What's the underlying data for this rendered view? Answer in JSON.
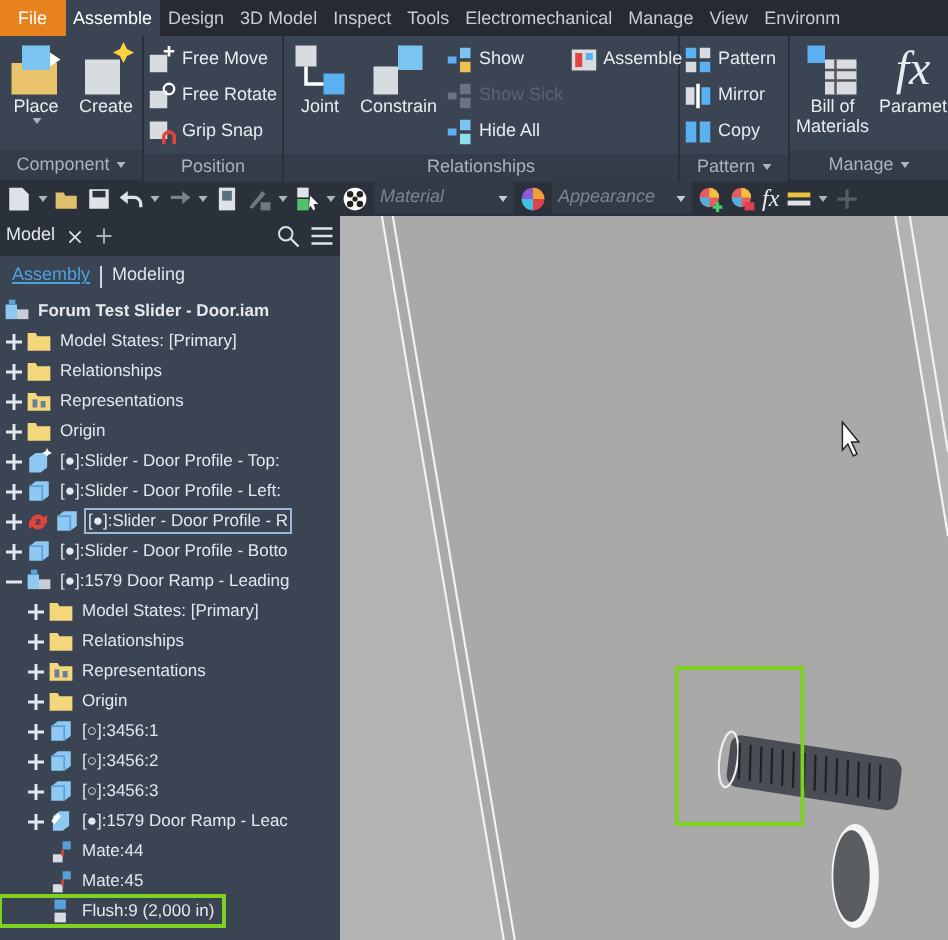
{
  "tabs": [
    {
      "label": "File",
      "kind": "file",
      "selected": false
    },
    {
      "label": "Assemble",
      "kind": "tab",
      "selected": true
    },
    {
      "label": "Design",
      "kind": "tab",
      "selected": false
    },
    {
      "label": "3D Model",
      "kind": "tab",
      "selected": false
    },
    {
      "label": "Inspect",
      "kind": "tab",
      "selected": false
    },
    {
      "label": "Tools",
      "kind": "tab",
      "selected": false
    },
    {
      "label": "Electromechanical",
      "kind": "tab",
      "selected": false
    },
    {
      "label": "Manage",
      "kind": "tab",
      "selected": false
    },
    {
      "label": "View",
      "kind": "tab",
      "selected": false
    },
    {
      "label": "Environm",
      "kind": "tab",
      "selected": false
    }
  ],
  "ribbon": {
    "panels": [
      {
        "title": "Component",
        "menu": true,
        "groups": [
          {
            "kind": "large",
            "tools": [
              {
                "label": "Place",
                "kind": "place",
                "menu": true,
                "disabled": false
              },
              {
                "label": "Create",
                "kind": "create",
                "menu": false,
                "disabled": false
              }
            ]
          }
        ]
      },
      {
        "title": "Position",
        "menu": false,
        "groups": [
          {
            "kind": "small",
            "tools": [
              {
                "label": "Free Move",
                "kind": "free-move",
                "disabled": false
              },
              {
                "label": "Free Rotate",
                "kind": "free-rotate",
                "disabled": false
              },
              {
                "label": "Grip Snap",
                "kind": "grip-snap",
                "disabled": false
              }
            ]
          }
        ]
      },
      {
        "title": "Relationships",
        "menu": false,
        "groups": [
          {
            "kind": "large",
            "tools": [
              {
                "label": "Joint",
                "kind": "joint",
                "menu": false,
                "disabled": false
              },
              {
                "label": "Constrain",
                "kind": "constrain",
                "menu": false,
                "disabled": false
              }
            ]
          },
          {
            "kind": "small",
            "tools": [
              {
                "label": "Show",
                "kind": "show",
                "disabled": false
              },
              {
                "label": "Show Sick",
                "kind": "show-sick",
                "disabled": true
              },
              {
                "label": "Hide All",
                "kind": "hide-all",
                "disabled": false
              }
            ]
          },
          {
            "kind": "small",
            "tools": [
              {
                "label": "Assemble",
                "kind": "assemble",
                "disabled": false
              }
            ]
          }
        ]
      },
      {
        "title": "Pattern",
        "menu": true,
        "groups": [
          {
            "kind": "small",
            "tools": [
              {
                "label": "Pattern",
                "kind": "pattern",
                "disabled": false
              },
              {
                "label": "Mirror",
                "kind": "mirror",
                "disabled": false
              },
              {
                "label": "Copy",
                "kind": "copy",
                "disabled": false
              }
            ]
          }
        ]
      },
      {
        "title": "Manage",
        "menu": true,
        "groups": [
          {
            "kind": "large",
            "tools": [
              {
                "label": "Bill of Materials",
                "kind": "bom",
                "menu": false,
                "disabled": false
              },
              {
                "label": "Paramet",
                "kind": "glyph",
                "glyph": "fx",
                "menu": false,
                "disabled": false
              }
            ]
          }
        ]
      }
    ]
  },
  "toolbar": [
    {
      "kind": "new",
      "menu": true,
      "disabled": false
    },
    {
      "kind": "open",
      "menu": false,
      "disabled": false
    },
    {
      "kind": "save",
      "menu": false,
      "disabled": false
    },
    {
      "kind": "undo",
      "menu": true,
      "disabled": false
    },
    {
      "kind": "redo",
      "menu": true,
      "disabled": true
    },
    {
      "kind": "device",
      "menu": false,
      "disabled": false
    },
    {
      "kind": "sketch",
      "menu": true,
      "disabled": true
    },
    {
      "kind": "select",
      "menu": true,
      "disabled": false
    },
    {
      "kind": "material-ball",
      "menu": false,
      "disabled": false
    },
    {
      "kind": "dropdown",
      "placeholder": "Material"
    },
    {
      "kind": "color-wheel",
      "menu": false,
      "disabled": false
    },
    {
      "kind": "dropdown",
      "placeholder": "Appearance"
    },
    {
      "kind": "color-add",
      "menu": false,
      "disabled": false
    },
    {
      "kind": "color-clear",
      "menu": false,
      "disabled": false
    },
    {
      "kind": "text",
      "label": "fx"
    },
    {
      "kind": "measure",
      "menu": true,
      "disabled": false
    },
    {
      "kind": "plus",
      "menu": false,
      "disabled": true
    }
  ],
  "browser": {
    "tabs": [
      {
        "label": "Model",
        "selected": true
      }
    ],
    "views": [
      {
        "label": "Assembly",
        "selected": true
      },
      {
        "label": "Modeling",
        "selected": false
      }
    ],
    "tree": {
      "label": "Forum Test Slider - Door.iam",
      "kind": "assembly",
      "selected": false,
      "highlighted": false,
      "children": [
        {
          "label": "Model States: [Primary]",
          "kind": "folder",
          "expanded": false,
          "selected": false,
          "highlighted": false,
          "out_of_date": false
        },
        {
          "label": "Relationships",
          "kind": "folder",
          "expanded": false,
          "selected": false,
          "highlighted": false,
          "out_of_date": false
        },
        {
          "label": "Representations",
          "kind": "representations",
          "expanded": false,
          "selected": false,
          "highlighted": false,
          "out_of_date": false
        },
        {
          "label": "Origin",
          "kind": "folder",
          "expanded": false,
          "selected": false,
          "highlighted": false,
          "out_of_date": false
        },
        {
          "label": "[●]:Slider - Door Profile - Top:",
          "kind": "part-new",
          "expanded": false,
          "selected": false,
          "highlighted": false,
          "out_of_date": false
        },
        {
          "label": "[●]:Slider - Door Profile - Left:",
          "kind": "part",
          "expanded": false,
          "selected": false,
          "highlighted": false,
          "out_of_date": false
        },
        {
          "label": "[●]:Slider - Door Profile - R",
          "kind": "part",
          "expanded": false,
          "selected": true,
          "highlighted": false,
          "out_of_date": true
        },
        {
          "label": "[●]:Slider - Door Profile - Botto",
          "kind": "part",
          "expanded": false,
          "selected": false,
          "highlighted": false,
          "out_of_date": false
        },
        {
          "label": "[●]:1579 Door Ramp - Leading",
          "kind": "assembly",
          "expanded": true,
          "selected": false,
          "highlighted": false,
          "out_of_date": false,
          "children": [
            {
              "label": "Model States: [Primary]",
              "kind": "folder",
              "expanded": false,
              "selected": false,
              "highlighted": false
            },
            {
              "label": "Relationships",
              "kind": "folder",
              "expanded": false,
              "selected": false,
              "highlighted": false
            },
            {
              "label": "Representations",
              "kind": "representations",
              "expanded": false,
              "selected": false,
              "highlighted": false
            },
            {
              "label": "Origin",
              "kind": "folder",
              "expanded": false,
              "selected": false,
              "highlighted": false
            },
            {
              "label": "[○]:3456:1",
              "kind": "part",
              "expanded": false,
              "selected": false,
              "highlighted": false
            },
            {
              "label": "[○]:3456:2",
              "kind": "part",
              "expanded": false,
              "selected": false,
              "highlighted": false
            },
            {
              "label": "[○]:3456:3",
              "kind": "part",
              "expanded": false,
              "selected": false,
              "highlighted": false
            },
            {
              "label": "[●]:1579 Door Ramp - Leac",
              "kind": "flexible",
              "expanded": false,
              "selected": false,
              "highlighted": false
            },
            {
              "label": "Mate:44",
              "kind": "constraint",
              "selected": false,
              "highlighted": false
            },
            {
              "label": "Mate:45",
              "kind": "constraint",
              "selected": false,
              "highlighted": false
            },
            {
              "label": "Flush:9 (2,000 in)",
              "kind": "flush",
              "selected": false,
              "highlighted": true
            }
          ]
        }
      ]
    }
  }
}
